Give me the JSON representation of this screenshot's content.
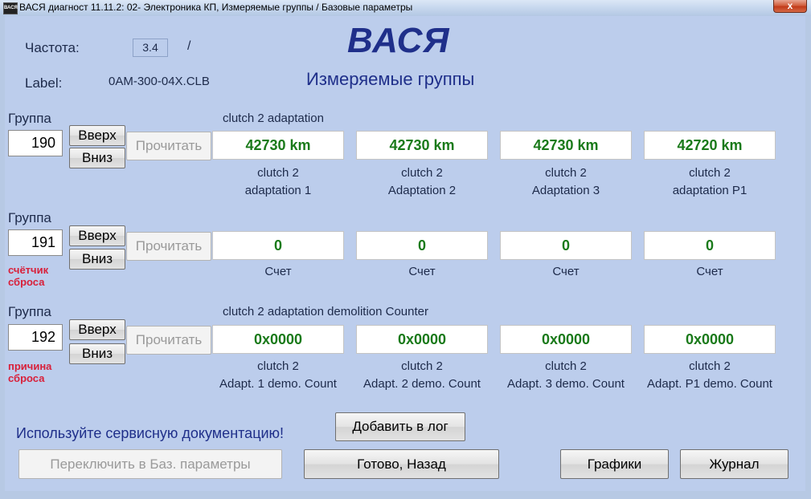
{
  "window": {
    "title": "ВАСЯ диагност 11.11.2: 02- Электроника КП,  Измеряемые группы / Базовые параметры",
    "icon_text": "ВАСЯ",
    "close_label": "x"
  },
  "header": {
    "freq_label": "Частота:",
    "freq_value": "3.4",
    "freq_sep": "/",
    "logo": "ВАСЯ",
    "subtitle": "Измеряемые группы",
    "label_label": "Label:",
    "label_value": "0AM-300-04X.CLB"
  },
  "groups": [
    {
      "title": "Группа",
      "number": "190",
      "up_label": "Вверх",
      "down_label": "Вниз",
      "read_label": "Прочитать",
      "description": "clutch 2 adaptation",
      "note_line1": "",
      "note_line2": "",
      "fields": [
        {
          "value": "42730 km",
          "cap1": "clutch 2",
          "cap2": "adaptation 1"
        },
        {
          "value": "42730 km",
          "cap1": "clutch 2",
          "cap2": "Adaptation 2"
        },
        {
          "value": "42730 km",
          "cap1": "clutch 2",
          "cap2": "Adaptation 3"
        },
        {
          "value": "42720 km",
          "cap1": "clutch 2",
          "cap2": "adaptation P1"
        }
      ]
    },
    {
      "title": "Группа",
      "number": "191",
      "up_label": "Вверх",
      "down_label": "Вниз",
      "read_label": "Прочитать",
      "description": "",
      "note_line1": "счётчик",
      "note_line2": "сброса",
      "fields": [
        {
          "value": "0",
          "cap1": "Счет",
          "cap2": ""
        },
        {
          "value": "0",
          "cap1": "Счет",
          "cap2": ""
        },
        {
          "value": "0",
          "cap1": "Счет",
          "cap2": ""
        },
        {
          "value": "0",
          "cap1": "Счет",
          "cap2": ""
        }
      ]
    },
    {
      "title": "Группа",
      "number": "192",
      "up_label": "Вверх",
      "down_label": "Вниз",
      "read_label": "Прочитать",
      "description": "clutch 2 adaptation demolition Counter",
      "note_line1": "причина",
      "note_line2": "сброса",
      "fields": [
        {
          "value": "0x0000",
          "cap1": "clutch 2",
          "cap2": "Adapt. 1 demo. Count"
        },
        {
          "value": "0x0000",
          "cap1": "clutch 2",
          "cap2": "Adapt. 2 demo. Count"
        },
        {
          "value": "0x0000",
          "cap1": "clutch 2",
          "cap2": "Adapt. 3 demo. Count"
        },
        {
          "value": "0x0000",
          "cap1": "clutch 2",
          "cap2": "Adapt. P1 demo. Count"
        }
      ]
    }
  ],
  "footer": {
    "warning": "Используйте сервисную документацию!",
    "add_log": "Добавить в лог",
    "switch_basic": "Переключить в Баз. параметры",
    "done_back": "Готово, Назад",
    "graphs": "Графики",
    "journal": "Журнал"
  },
  "colors": {
    "background": "#bccdec",
    "value_green": "#1a7a1a",
    "note_red": "#d8203a",
    "logo_blue": "#1f2f8a"
  }
}
